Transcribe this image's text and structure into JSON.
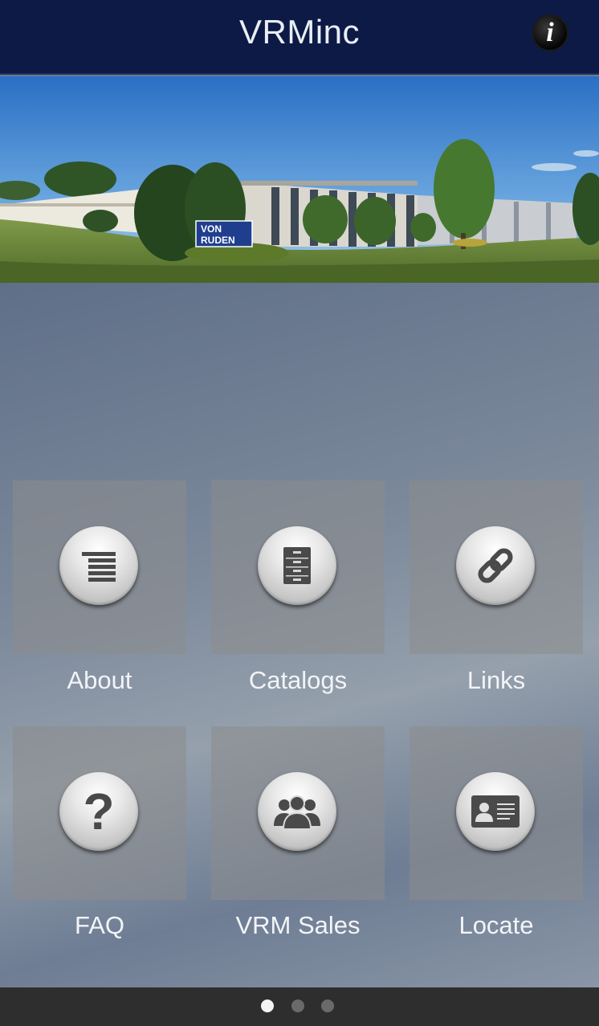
{
  "header": {
    "title": "VRMinc",
    "info_icon": "info-icon",
    "info_glyph": "i"
  },
  "hero": {
    "sign_line1": "VON",
    "sign_line2": "RUDEN"
  },
  "tiles": [
    {
      "label": "About",
      "icon": "menu-lines-icon"
    },
    {
      "label": "Catalogs",
      "icon": "file-cabinet-icon"
    },
    {
      "label": "Links",
      "icon": "chain-link-icon"
    },
    {
      "label": "FAQ",
      "icon": "question-mark-icon"
    },
    {
      "label": "VRM Sales",
      "icon": "people-group-icon"
    },
    {
      "label": "Locate",
      "icon": "contact-card-icon"
    }
  ],
  "faq_glyph": "?",
  "pager": {
    "pages": 3,
    "current": 1
  },
  "colors": {
    "header_bg": "#0c1a45",
    "footer_bg": "#2e2e2e"
  }
}
